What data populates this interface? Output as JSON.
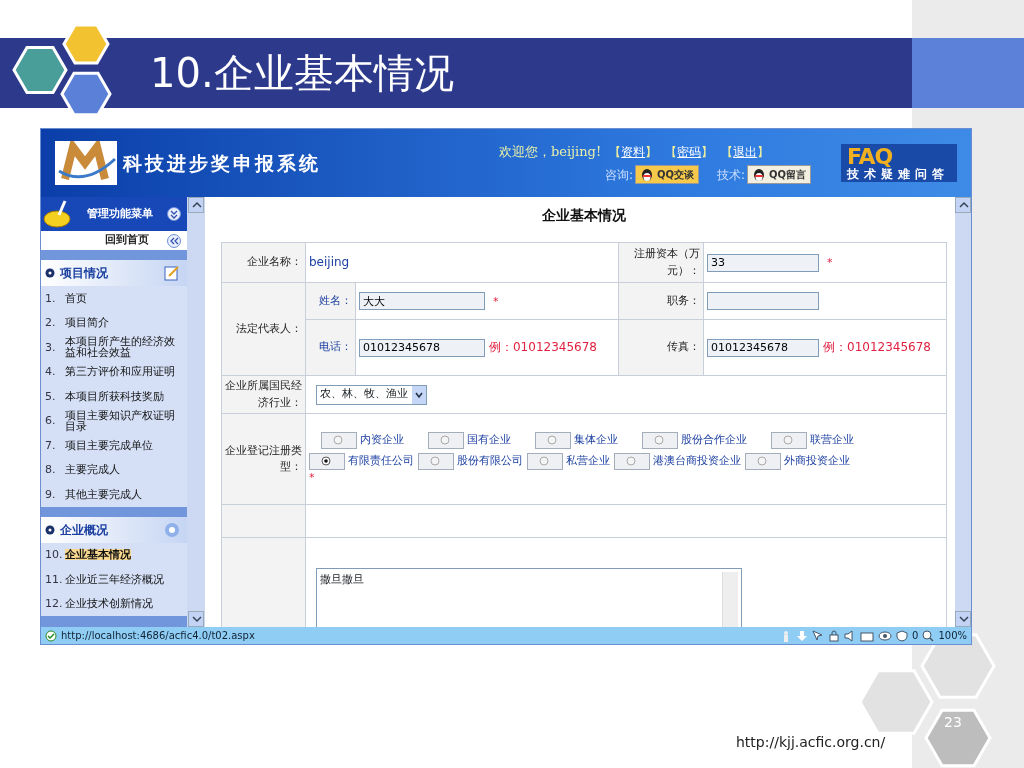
{
  "slide": {
    "title": "10.企业基本情况",
    "slide_number": "23",
    "url": "http://kjj.acfic.org.cn/"
  },
  "header": {
    "system_title": "科技进步奖申报系统",
    "welcome": "欢迎您，beijing!",
    "links": [
      {
        "open": "【",
        "label": "资料",
        "close": "】"
      },
      {
        "open": "【",
        "label": "密码",
        "close": "】"
      },
      {
        "open": "【",
        "label": "退出",
        "close": "】"
      }
    ],
    "consult_label": "咨询:",
    "qq_chat": "QQ交谈",
    "tech_label": "技术:",
    "qq_message": "QQ留言",
    "faq": "FAQ",
    "faq_subtitle": "技术疑难问答"
  },
  "sidebar": {
    "menu_title": "管理功能菜单",
    "home_link": "回到首页",
    "sections": [
      {
        "title": "项目情况",
        "items": [
          {
            "number": "1.",
            "label": "首页",
            "selected": false
          },
          {
            "number": "2.",
            "label": "项目简介",
            "selected": false
          },
          {
            "number": "3.",
            "label": "本项目所产生的经济效益和社会效益",
            "selected": false
          },
          {
            "number": "4.",
            "label": "第三方评价和应用证明",
            "selected": false
          },
          {
            "number": "5.",
            "label": "本项目所获科技奖励",
            "selected": false
          },
          {
            "number": "6.",
            "label": "项目主要知识产权证明目录",
            "selected": false
          },
          {
            "number": "7.",
            "label": "项目主要完成单位",
            "selected": false
          },
          {
            "number": "8.",
            "label": "主要完成人",
            "selected": false
          },
          {
            "number": "9.",
            "label": "其他主要完成人",
            "selected": false
          }
        ]
      },
      {
        "title": "企业概况",
        "items": [
          {
            "number": "10.",
            "label": "企业基本情况",
            "selected": true
          },
          {
            "number": "11.",
            "label": "企业近三年经济概况",
            "selected": false
          },
          {
            "number": "12.",
            "label": "企业技术创新情况",
            "selected": false
          }
        ]
      }
    ]
  },
  "form": {
    "title": "企业基本情况",
    "company": {
      "label": "企业名称：",
      "value": "beijing"
    },
    "capital": {
      "label": "注册资本（万元）：",
      "value": "33",
      "required": "*"
    },
    "legal_rep": {
      "label": "法定代表人：",
      "name": {
        "label": "姓名：",
        "value": "大大",
        "required": "*"
      },
      "position": {
        "label": "职务："
      },
      "phone": {
        "label": "电话：",
        "value": "01012345678",
        "example": "例：01012345678"
      },
      "fax": {
        "label": "传真：",
        "value": "01012345678",
        "example": "例：01012345678"
      }
    },
    "industry": {
      "label": "企业所属国民经济行业：",
      "value": "农、林、牧、渔业"
    },
    "registration_type": {
      "label": "企业登记注册类型：",
      "required": "*",
      "option_groups": [
        {
          "options": [
            {
              "label": "内资企业",
              "selected": false
            },
            {
              "label": "国有企业",
              "selected": false
            },
            {
              "label": "集体企业",
              "selected": false
            },
            {
              "label": "股份合作企业",
              "selected": false
            },
            {
              "label": "联营企业",
              "selected": false
            }
          ]
        },
        {
          "options": [
            {
              "label": "有限责任公司",
              "selected": true
            },
            {
              "label": "股份有限公司",
              "selected": false
            },
            {
              "label": "私营企业",
              "selected": false
            },
            {
              "label": "港澳台商投资企业",
              "selected": false
            },
            {
              "label": "外商投资企业",
              "selected": false
            }
          ]
        }
      ]
    },
    "description": {
      "value": "撒旦撒旦"
    }
  },
  "status_bar": {
    "url": "http://localhost:4686/acfic4.0/t02.aspx",
    "privacy_count": "0",
    "zoom": "100%"
  }
}
